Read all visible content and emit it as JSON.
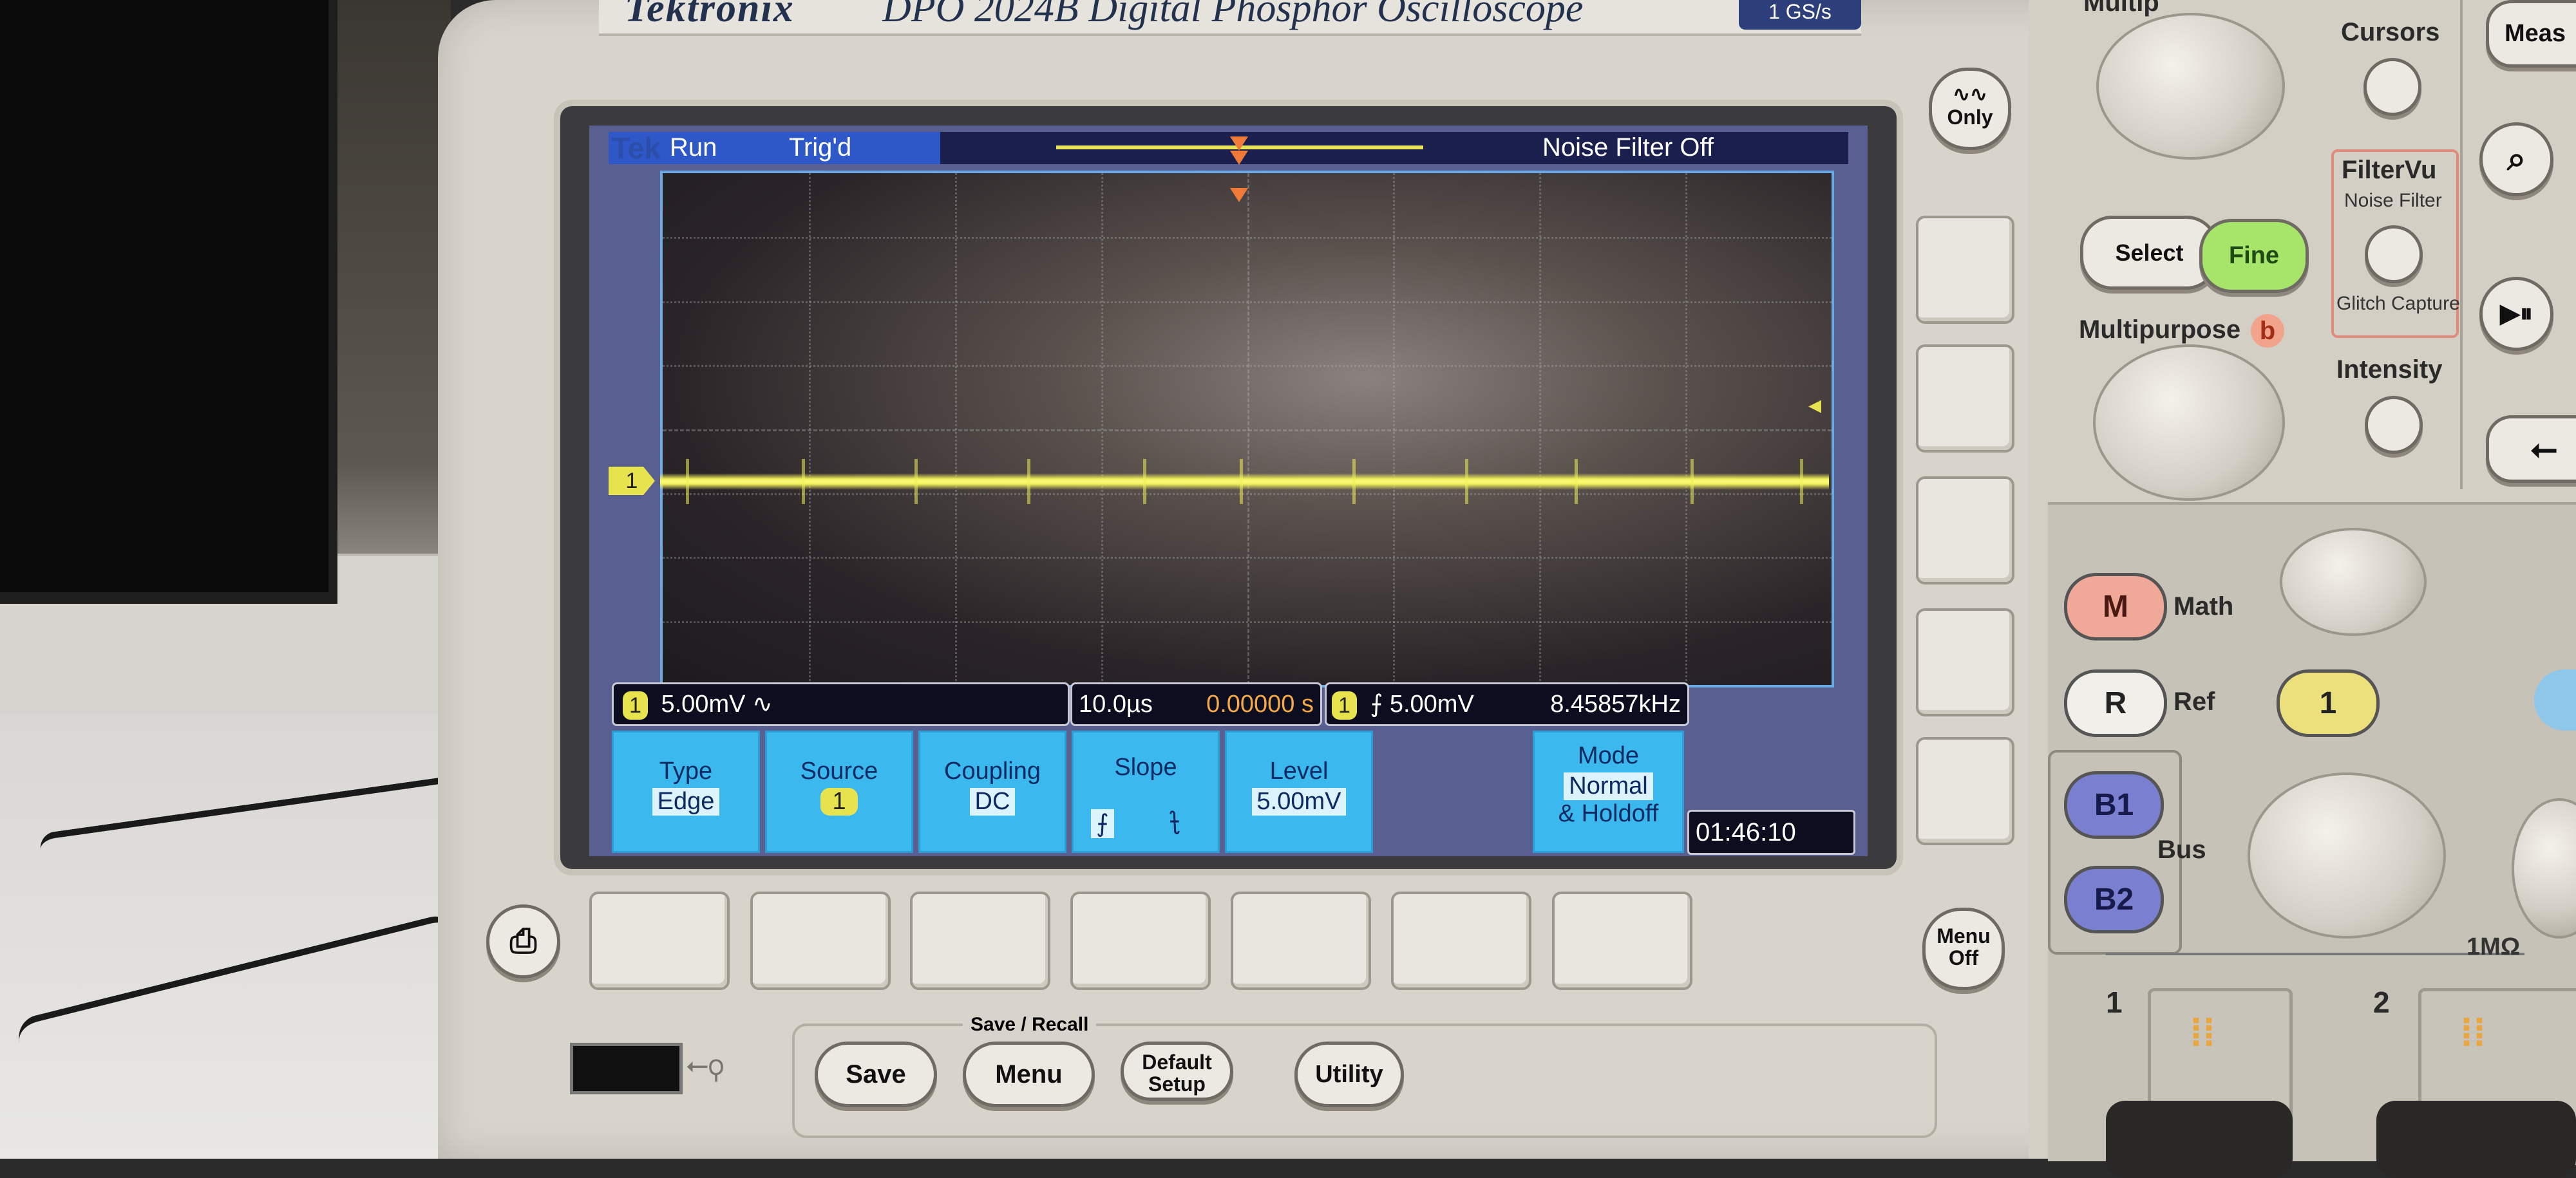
{
  "device": {
    "brand": "Tektronix",
    "model": "DPO 2024B Digital Phosphor Oscilloscope",
    "sample_rate_badge": "1 GS/s"
  },
  "screen": {
    "logo": "Tek",
    "status": {
      "run": "Run",
      "trigger_state": "Trig'd",
      "noise_filter": "Noise Filter Off"
    },
    "channel_marker": "1",
    "readouts": {
      "channel": {
        "chip": "1",
        "scale": "5.00mV",
        "coupling_icon": "∿"
      },
      "timebase": {
        "scale": "10.0µs",
        "position": "0.00000 s"
      },
      "trigger": {
        "chip": "1",
        "slope_level": "⨍ 5.00mV",
        "frequency": "8.45857kHz"
      }
    },
    "menu": {
      "type": {
        "label": "Type",
        "value": "Edge"
      },
      "source": {
        "label": "Source",
        "value": "1"
      },
      "coupling": {
        "label": "Coupling",
        "value": "DC"
      },
      "slope": {
        "label": "Slope",
        "rising": "⨍",
        "falling": "⨍"
      },
      "level": {
        "label": "Level",
        "value": "5.00mV"
      },
      "mode": {
        "label": "Mode",
        "value": "Normal",
        "sub": "& Holdoff"
      }
    },
    "clock": "01:46:10"
  },
  "panel": {
    "only_button": "Only",
    "menu_off_button": "Menu Off",
    "select_button": "Select",
    "fine_button": "Fine",
    "multipurpose_b": "Multipurpose",
    "multipurpose_b_letter": "b",
    "multipurpose_a_partial": "Multip",
    "cursors": "Cursors",
    "measure_partial": "Meas",
    "filtervu": {
      "title": "FilterVu",
      "noise": "Noise Filter",
      "glitch": "Glitch Capture"
    },
    "intensity": "Intensity",
    "math_btn": "M",
    "math_label": "Math",
    "ref_btn": "R",
    "ref_label": "Ref",
    "ch1_btn": "1",
    "bus_b1": "B1",
    "bus_b2": "B2",
    "bus_label": "Bus",
    "impedance": "1MΩ",
    "input1": "1",
    "input2": "2",
    "save_recall_title": "Save / Recall",
    "save": "Save",
    "menu": "Menu",
    "default_setup": "Default Setup",
    "utility": "Utility"
  }
}
